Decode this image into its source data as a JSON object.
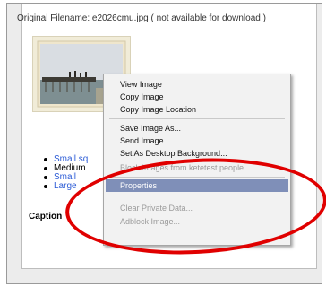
{
  "header": {
    "filename_text": "Original Filename: e2026cmu.jpg ( not available for download )"
  },
  "sizes": [
    {
      "label": "Small sq",
      "link": true
    },
    {
      "label": "Medium",
      "link": false
    },
    {
      "label": "Small",
      "link": true
    },
    {
      "label": "Large",
      "link": true
    }
  ],
  "caption": {
    "label": "Caption"
  },
  "context_menu": {
    "items": [
      {
        "label": "View Image",
        "accel": "I",
        "state": "enabled"
      },
      {
        "label": "Copy Image",
        "accel": "y",
        "state": "enabled"
      },
      {
        "label": "Copy Image Location",
        "accel": "o",
        "state": "enabled"
      },
      {
        "label": "Save Image As...",
        "accel": "v",
        "state": "enabled"
      },
      {
        "label": "Send Image...",
        "accel": "n",
        "state": "enabled"
      },
      {
        "label": "Set As Desktop Background...",
        "accel": "S",
        "state": "enabled"
      },
      {
        "label": "Block Images from ketetest.people...",
        "accel": "",
        "state": "disabled"
      },
      {
        "label": "Properties",
        "accel": "P",
        "state": "selected"
      },
      {
        "label": "Clear Private Data...",
        "accel": "",
        "state": "disabled"
      },
      {
        "label": "Adblock Image...",
        "accel": "",
        "state": "disabled"
      }
    ]
  },
  "colors": {
    "highlight": "#7f8fb8",
    "link": "#2b5bd6",
    "annotation": "#e00000"
  }
}
